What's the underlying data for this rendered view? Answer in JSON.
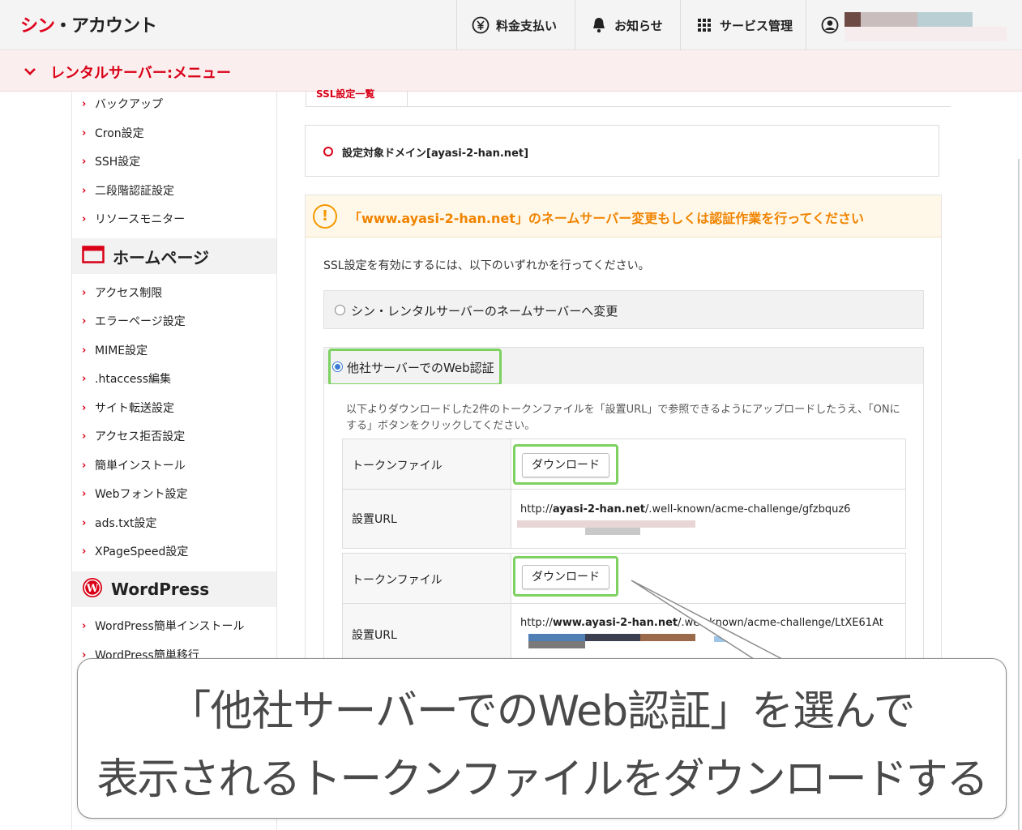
{
  "header": {
    "logo_red": "シン",
    "logo_dark": "・アカウント",
    "nav": [
      {
        "label": "料金支払い",
        "icon": "yen-icon"
      },
      {
        "label": "お知らせ",
        "icon": "bell-icon"
      },
      {
        "label": "サービス管理",
        "icon": "grid-icon"
      }
    ],
    "account_icon": "user-circle-icon"
  },
  "menubar": {
    "title": "レンタルサーバー:メニュー",
    "icon": "chevron-down-icon"
  },
  "sidebar": {
    "items_top": [
      "バックアップ",
      "Cron設定",
      "SSH設定",
      "二段階認証設定",
      "リソースモニター"
    ],
    "section_homepage": "ホームページ",
    "items_homepage": [
      "アクセス制限",
      "エラーページ設定",
      "MIME設定",
      ".htaccess編集",
      "サイト転送設定",
      "アクセス拒否設定",
      "簡単インストール",
      "Webフォント設定",
      "ads.txt設定",
      "XPageSpeed設定"
    ],
    "section_wordpress": "WordPress",
    "items_wordpress": [
      "WordPress簡単インストール",
      "WordPress簡単移行"
    ]
  },
  "main": {
    "tab_label": "SSL設定一覧",
    "domain_label": "設定対象ドメイン[ayasi-2-han.net]",
    "warning": "「www.ayasi-2-han.net」のネームサーバー変更もしくは認証作業を行ってください",
    "intro": "SSL設定を有効にするには、以下のいずれかを行ってください。",
    "option1": "シン・レンタルサーバーのネームサーバーへ変更",
    "option2": "他社サーバーでのWeb認証",
    "option2_desc": "以下よりダウンロードした2件のトークンファイルを「設置URL」で参照できるようにアップロードしたうえ、「ONにする」ボタンをクリックしてください。",
    "token_label": "トークンファイル",
    "url_label": "設置URL",
    "download_label": "ダウンロード",
    "url1_prefix": "http://",
    "url1_domain": "ayasi-2-han.net",
    "url1_suffix": "/.well-known/acme-challenge/gfzbquz6",
    "url2_prefix": "http://",
    "url2_domain": "www.ayasi-2-han.net",
    "url2_suffix": "/.well-known/acme-challenge/LtXE61At"
  },
  "callout": {
    "line1": "「他社サーバーでのWeb認証」を選んで",
    "line2": "表示されるトークンファイルをダウンロードする"
  },
  "colors": {
    "brand_red": "#d90017",
    "highlight_green": "#7cd160",
    "warning_orange": "#f08300"
  }
}
